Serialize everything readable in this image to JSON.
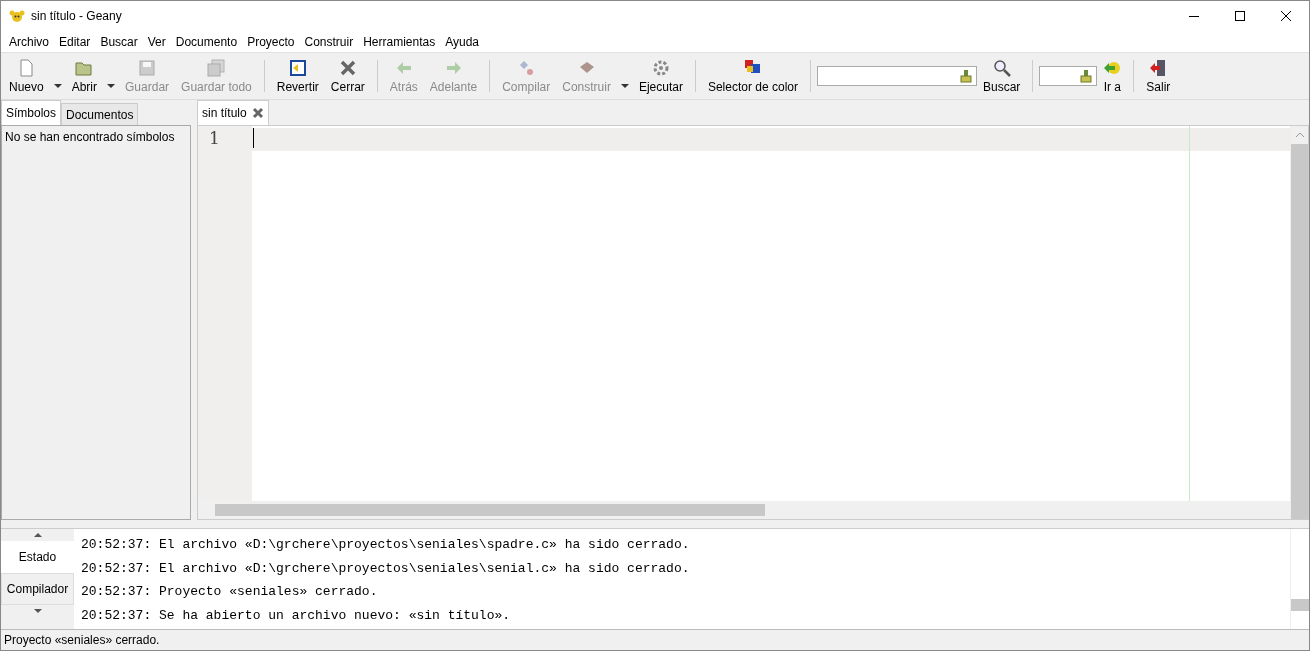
{
  "window": {
    "title": "sin título - Geany"
  },
  "menu": [
    "Archivo",
    "Editar",
    "Buscar",
    "Ver",
    "Documento",
    "Proyecto",
    "Construir",
    "Herramientas",
    "Ayuda"
  ],
  "toolbar": [
    {
      "kind": "button",
      "label": "Nuevo",
      "disabled": false
    },
    {
      "kind": "dropdown"
    },
    {
      "kind": "button",
      "label": "Abrir",
      "disabled": false
    },
    {
      "kind": "dropdown"
    },
    {
      "kind": "button",
      "label": "Guardar",
      "disabled": true
    },
    {
      "kind": "button",
      "label": "Guardar todo",
      "disabled": true
    },
    {
      "kind": "separator"
    },
    {
      "kind": "button",
      "label": "Revertir",
      "disabled": false
    },
    {
      "kind": "button",
      "label": "Cerrar",
      "disabled": false
    },
    {
      "kind": "separator"
    },
    {
      "kind": "button",
      "label": "Atrás",
      "disabled": true
    },
    {
      "kind": "button",
      "label": "Adelante",
      "disabled": true
    },
    {
      "kind": "separator"
    },
    {
      "kind": "button",
      "label": "Compilar",
      "disabled": true
    },
    {
      "kind": "button",
      "label": "Construir",
      "disabled": true
    },
    {
      "kind": "dropdown"
    },
    {
      "kind": "button",
      "label": "Ejecutar",
      "disabled": false
    },
    {
      "kind": "separator"
    },
    {
      "kind": "button",
      "label": "Selector de color",
      "disabled": false
    },
    {
      "kind": "separator"
    },
    {
      "kind": "search-field"
    },
    {
      "kind": "button",
      "label": "Buscar",
      "disabled": false
    },
    {
      "kind": "separator"
    },
    {
      "kind": "goto-field"
    },
    {
      "kind": "button",
      "label": "Ir a",
      "disabled": false
    },
    {
      "kind": "separator"
    },
    {
      "kind": "button",
      "label": "Salir",
      "disabled": false
    }
  ],
  "sidebar": {
    "tabs": [
      {
        "label": "Símbolos",
        "selected": true
      },
      {
        "label": "Documentos",
        "selected": false
      }
    ],
    "message": "No se han encontrado símbolos"
  },
  "editor": {
    "tabs": [
      {
        "label": "sin título",
        "selected": true
      }
    ],
    "line_numbers": [
      "1"
    ]
  },
  "messages": {
    "tabs": [
      {
        "label": "Estado",
        "selected": true
      },
      {
        "label": "Compilador",
        "selected": false
      }
    ],
    "lines": [
      "20:52:37: El archivo «D:\\grchere\\proyectos\\seniales\\spadre.c» ha sido cerrado.",
      "20:52:37: El archivo «D:\\grchere\\proyectos\\seniales\\senial.c» ha sido cerrado.",
      "20:52:37: Proyecto «seniales» cerrado.",
      "20:52:37: Se ha abierto un archivo nuevo: «sin título»."
    ]
  },
  "status_bar": "Proyecto «seniales» cerrado."
}
